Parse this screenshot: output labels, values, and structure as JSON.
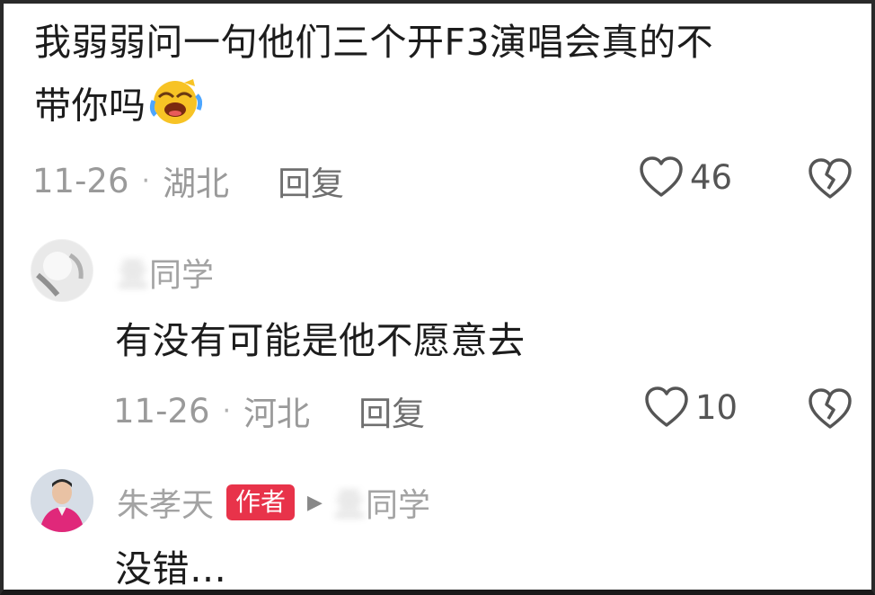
{
  "comments": [
    {
      "text_line1": "我弱弱问一句他们三个开F3演唱会真的不",
      "text_line2": "带你吗",
      "emoji": "laughing-crying-emoji",
      "date": "11-26",
      "location": "湖北",
      "reply_label": "回复",
      "likes": "46"
    },
    {
      "username_blurred": "亖",
      "username_suffix": "同学",
      "text": "有没有可能是他不愿意去",
      "date": "11-26",
      "location": "河北",
      "reply_label": "回复",
      "likes": "10"
    },
    {
      "username": "朱孝天",
      "author_badge": "作者",
      "reply_to_blurred": "亖",
      "reply_to_suffix": "同学",
      "text": "没错…"
    }
  ],
  "separator": "·",
  "icons": {
    "like": "heart-outline-icon",
    "dislike": "broken-heart-icon",
    "reply_arrow": "play-arrow-icon"
  },
  "colors": {
    "author_badge": "#e8334a",
    "meta_text": "#9a9a9a"
  }
}
